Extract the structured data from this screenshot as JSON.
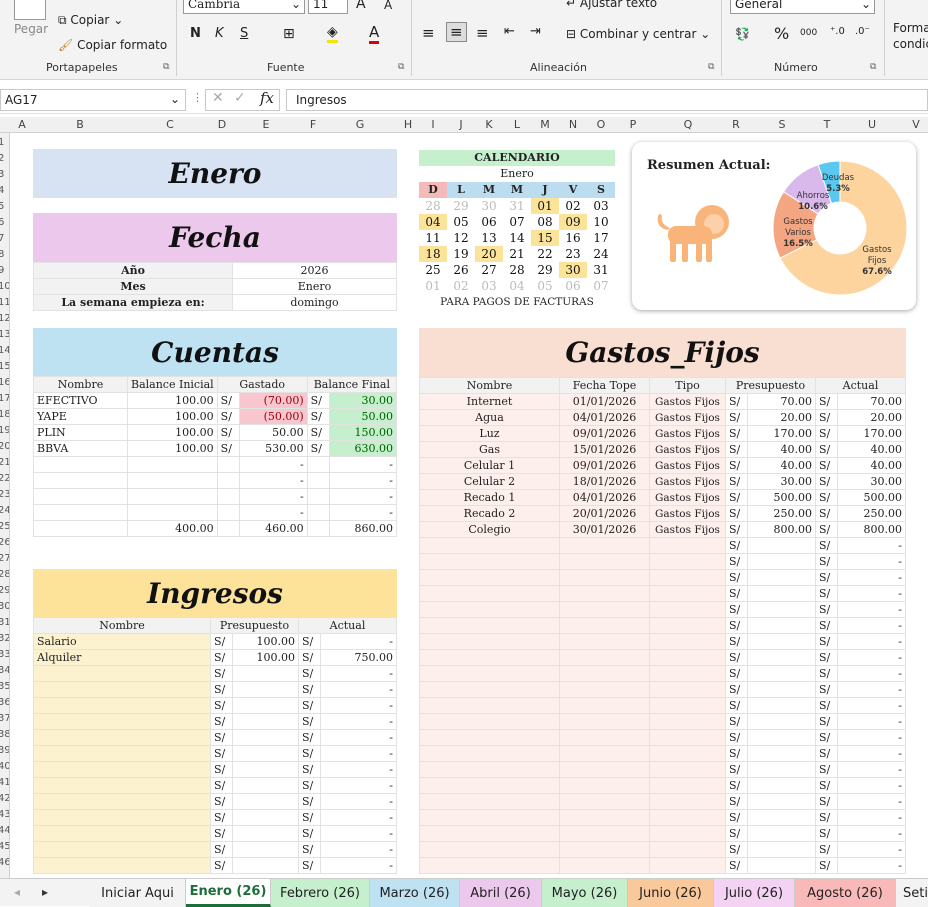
{
  "ribbon": {
    "paste_label": "Pegar",
    "copy_label": "Copiar",
    "format_painter_label": "Copiar formato",
    "clipboard_group": "Portapapeles",
    "font_name": "Cambria",
    "font_size": "11",
    "font_group": "Fuente",
    "bold": "N",
    "italic": "K",
    "underline": "S",
    "wrap_text": "Ajustar texto",
    "merge_center": "Combinar y centrar",
    "alignment_group": "Alineación",
    "number_format": "General",
    "percent": "%",
    "thousands": "000",
    "number_group": "Número",
    "conditional_format": "Formato condicional"
  },
  "formula_bar": {
    "name_box": "AG17",
    "formula": "Ingresos",
    "fx": "fx"
  },
  "columns": [
    "A",
    "B",
    "C",
    "D",
    "E",
    "F",
    "G",
    "H",
    "I",
    "J",
    "K",
    "L",
    "M",
    "N",
    "O",
    "P",
    "Q",
    "R",
    "S",
    "T",
    "U",
    "V"
  ],
  "rows": [
    "1",
    "2",
    "3",
    "4",
    "5",
    "6",
    "7",
    "8",
    "9",
    "10",
    "11",
    "12",
    "13",
    "14",
    "15",
    "16",
    "17",
    "18",
    "19",
    "20",
    "21",
    "22",
    "23",
    "24",
    "25",
    "26",
    "27",
    "28",
    "29",
    "30",
    "31",
    "32",
    "33",
    "34",
    "35",
    "36",
    "37",
    "38",
    "39",
    "40",
    "41",
    "42",
    "43",
    "44",
    "45",
    "46"
  ],
  "month_title": "Enero",
  "fecha": {
    "title": "Fecha",
    "rows": [
      {
        "label": "Año",
        "value": "2026"
      },
      {
        "label": "Mes",
        "value": "Enero"
      },
      {
        "label": "La semana empieza en:",
        "value": "domingo"
      }
    ]
  },
  "calendar": {
    "title": "CALENDARIO",
    "month": "Enero",
    "days": [
      "D",
      "L",
      "M",
      "M",
      "J",
      "V",
      "S"
    ],
    "weeks": [
      [
        "28",
        "29",
        "30",
        "31",
        "01",
        "02",
        "03"
      ],
      [
        "04",
        "05",
        "06",
        "07",
        "08",
        "09",
        "10"
      ],
      [
        "11",
        "12",
        "13",
        "14",
        "15",
        "16",
        "17"
      ],
      [
        "18",
        "19",
        "20",
        "21",
        "22",
        "23",
        "24"
      ],
      [
        "25",
        "26",
        "27",
        "28",
        "29",
        "30",
        "31"
      ],
      [
        "01",
        "02",
        "03",
        "04",
        "05",
        "06",
        "07"
      ]
    ],
    "footer": "PARA PAGOS DE FACTURAS"
  },
  "summary": {
    "title": "Resumen Actual:",
    "icon": "lion-icon"
  },
  "chart_data": {
    "type": "pie",
    "title": "Resumen Actual:",
    "categories": [
      "Gastos Fijos",
      "Gastos Varios",
      "Ahorros",
      "Deudas"
    ],
    "values": [
      67.6,
      16.5,
      10.6,
      5.3
    ],
    "colors": [
      "#fdd49e",
      "#f4a582",
      "#d9b8ec",
      "#5bc8f0"
    ],
    "labels": [
      "Gastos Fijos 67.6%",
      "Gastos Varios 16.5%",
      "Ahorros 10.6%",
      "Deudas 5.3%"
    ]
  },
  "cuentas": {
    "title": "Cuentas",
    "headers": [
      "Nombre",
      "Balance Inicial",
      "Gastado",
      "Balance Final"
    ],
    "currency": "S/",
    "rows": [
      {
        "name": "EFECTIVO",
        "inicial": "100.00",
        "gastado": "(70.00)",
        "final": "30.00",
        "neg": true
      },
      {
        "name": "YAPE",
        "inicial": "100.00",
        "gastado": "(50.00)",
        "final": "50.00",
        "neg": true
      },
      {
        "name": "PLIN",
        "inicial": "100.00",
        "gastado": "50.00",
        "final": "150.00",
        "neg": false
      },
      {
        "name": "BBVA",
        "inicial": "100.00",
        "gastado": "530.00",
        "final": "630.00",
        "neg": false
      }
    ],
    "dash": "-",
    "totals": {
      "inicial": "400.00",
      "gastado": "460.00",
      "final": "860.00"
    }
  },
  "ingresos": {
    "title": "Ingresos",
    "headers": [
      "Nombre",
      "Presupuesto",
      "Actual"
    ],
    "currency": "S/",
    "dash": "-",
    "rows": [
      {
        "name": "Salario",
        "presupuesto": "100.00",
        "actual": "-"
      },
      {
        "name": "Alquiler",
        "presupuesto": "100.00",
        "actual": "750.00"
      }
    ]
  },
  "gastos": {
    "title": "Gastos_Fijos",
    "headers": [
      "Nombre",
      "Fecha Tope",
      "Tipo",
      "Presupuesto",
      "Actual"
    ],
    "currency": "S/",
    "dash": "-",
    "rows": [
      {
        "name": "Internet",
        "fecha": "01/01/2026",
        "tipo": "Gastos Fijos",
        "presupuesto": "70.00",
        "actual": "70.00"
      },
      {
        "name": "Agua",
        "fecha": "04/01/2026",
        "tipo": "Gastos Fijos",
        "presupuesto": "20.00",
        "actual": "20.00"
      },
      {
        "name": "Luz",
        "fecha": "09/01/2026",
        "tipo": "Gastos Fijos",
        "presupuesto": "170.00",
        "actual": "170.00"
      },
      {
        "name": "Gas",
        "fecha": "15/01/2026",
        "tipo": "Gastos Fijos",
        "presupuesto": "40.00",
        "actual": "40.00"
      },
      {
        "name": "Celular 1",
        "fecha": "09/01/2026",
        "tipo": "Gastos Fijos",
        "presupuesto": "40.00",
        "actual": "40.00"
      },
      {
        "name": "Celular 2",
        "fecha": "18/01/2026",
        "tipo": "Gastos Fijos",
        "presupuesto": "30.00",
        "actual": "30.00"
      },
      {
        "name": "Recado 1",
        "fecha": "04/01/2026",
        "tipo": "Gastos Fijos",
        "presupuesto": "500.00",
        "actual": "500.00"
      },
      {
        "name": "Recado 2",
        "fecha": "20/01/2026",
        "tipo": "Gastos Fijos",
        "presupuesto": "250.00",
        "actual": "250.00"
      },
      {
        "name": "Colegio",
        "fecha": "30/01/2026",
        "tipo": "Gastos Fijos",
        "presupuesto": "800.00",
        "actual": "800.00"
      }
    ]
  },
  "tabs": [
    "Iniciar Aqui",
    "Enero (26)",
    "Febrero (26)",
    "Marzo (26)",
    "Abril (26)",
    "Mayo (26)",
    "Junio (26)",
    "Julio (26)",
    "Agosto (26)",
    "Seti"
  ],
  "active_tab": "Enero (26)"
}
